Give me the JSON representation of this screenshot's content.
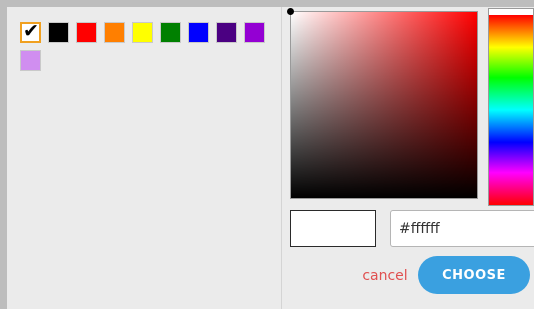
{
  "palette": {
    "swatches": [
      {
        "name": "white",
        "color": "#ffffff",
        "selected": true
      },
      {
        "name": "black",
        "color": "#000000"
      },
      {
        "name": "red",
        "color": "#ff0000"
      },
      {
        "name": "orange",
        "color": "#ff7f00"
      },
      {
        "name": "yellow",
        "color": "#ffff00"
      },
      {
        "name": "green",
        "color": "#008000"
      },
      {
        "name": "blue",
        "color": "#0000ff"
      },
      {
        "name": "indigo",
        "color": "#4b0082"
      },
      {
        "name": "violet",
        "color": "#9400d3"
      },
      {
        "name": "light-purple",
        "color": "#d08ef0"
      }
    ],
    "selected_check": "✔"
  },
  "picker": {
    "hue_color": "#ff0000",
    "hue_level": 0.0,
    "saturation": 0.0,
    "value": 1.0,
    "preview_color": "#ffffff"
  },
  "hex": {
    "value": "#ffffff"
  },
  "actions": {
    "cancel_label": "cancel",
    "choose_label": "CHOOSE"
  },
  "colors": {
    "accent": "#3aa0e0",
    "cancel_text": "#e05050",
    "selected_border": "#f0a020"
  }
}
